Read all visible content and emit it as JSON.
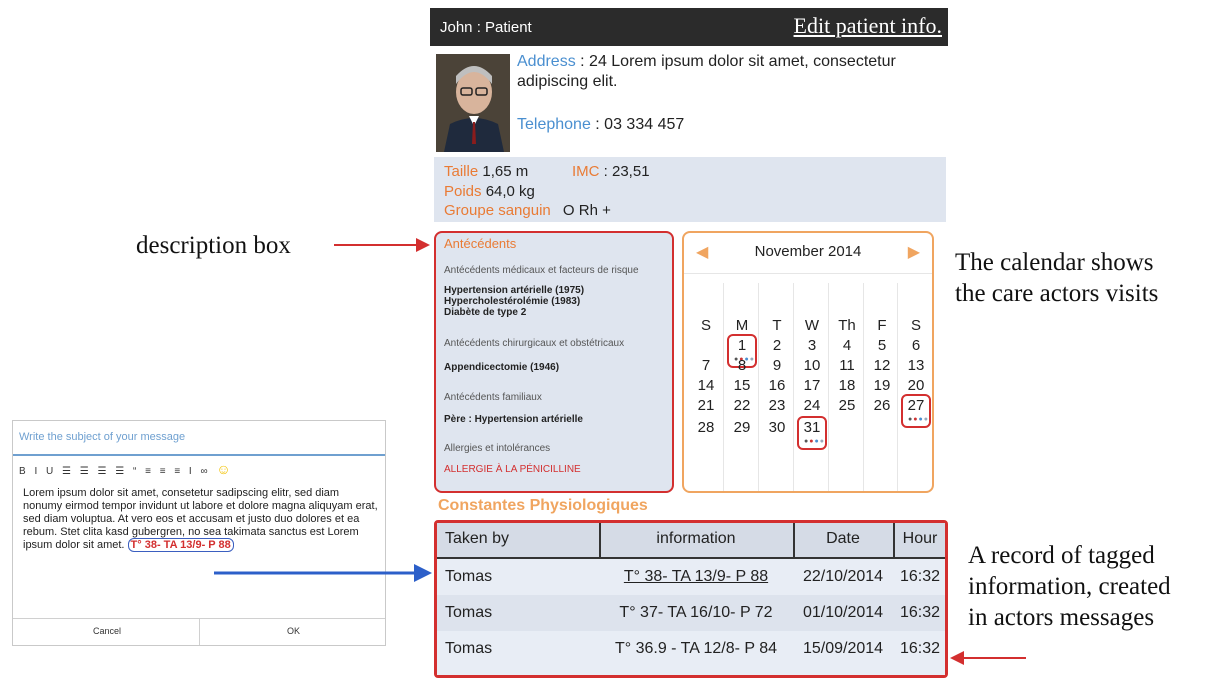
{
  "header": {
    "title": "John : Patient",
    "edit_label": "Edit patient info."
  },
  "patient": {
    "address_label": "Address",
    "address_value": " : 24 Lorem ipsum dolor sit amet, consectetur",
    "address_line2": "adipiscing elit.",
    "phone_label": "Telephone",
    "phone_value": " : 03 334 457"
  },
  "stats": {
    "taille_label": "Taille",
    "taille_value": " 1,65 m",
    "imc_label": "IMC",
    "imc_value": " : 23,51",
    "poids_label": "Poids",
    "poids_value": " 64,0 kg",
    "groupe_label": "Groupe sanguin",
    "groupe_value": "O Rh +"
  },
  "antecedents": {
    "title": "Antécédents",
    "sections": [
      {
        "heading": "Antécédents médicaux et facteurs de risque",
        "items": [
          "Hypertension artérielle (1975)",
          "Hypercholestérolémie (1983)",
          "Diabète de type 2"
        ]
      },
      {
        "heading": "Antécédents chirurgicaux et obstétricaux",
        "items": [
          "Appendicectomie (1946)"
        ]
      },
      {
        "heading": "Antécédents familiaux",
        "items": [
          "Père : Hypertension artérielle"
        ]
      },
      {
        "heading": "Allergies et intolérances",
        "items": [
          "ALLERGIE À LA PÉNICILLINE"
        ]
      }
    ]
  },
  "calendar": {
    "month": "November 2014",
    "prev_icon": "caret-left-icon",
    "next_icon": "caret-right-icon",
    "weekdays": [
      "S",
      "M",
      "T",
      "W",
      "Th",
      "F",
      "S"
    ],
    "weeks": [
      [
        "",
        "1",
        "2",
        "3",
        "4",
        "5",
        "6"
      ],
      [
        "7",
        "8",
        "9",
        "10",
        "11",
        "12",
        "13"
      ],
      [
        "14",
        "15",
        "16",
        "17",
        "18",
        "19",
        "20"
      ],
      [
        "21",
        "22",
        "23",
        "24",
        "25",
        "26",
        "27"
      ],
      [
        "28",
        "29",
        "30",
        "31",
        "",
        "",
        ""
      ]
    ],
    "marked_days": [
      "1",
      "27",
      "31"
    ]
  },
  "constantes": {
    "title": "Constantes Physiologiques",
    "columns": [
      "Taken by",
      "information",
      "Date",
      "Hour"
    ],
    "rows": [
      [
        "Tomas",
        "T° 38- TA 13/9- P 88",
        "22/10/2014",
        "16:32"
      ],
      [
        "Tomas",
        "T° 37- TA 16/10- P 72",
        "01/10/2014",
        "16:32"
      ],
      [
        "Tomas",
        "T° 36.9 - TA 12/8- P 84",
        "15/09/2014",
        "16:32"
      ]
    ]
  },
  "composer": {
    "subject_placeholder": "Write the subject of your message",
    "toolbar": "B I U ☰ ☰ ☰ ☰ “ ≡ ≡ ≡ I ∞",
    "body": "Lorem ipsum dolor sit amet, consetetur sadipscing elitr, sed diam nonumy eirmod tempor invidunt ut labore et dolore magna aliquyam erat, sed diam voluptua. At vero eos et accusam et justo duo dolores et ea rebum. Stet clita kasd gubergren, no sea takimata sanctus est Lorem ipsum dolor sit amet. ",
    "tag": "T° 38- TA 13/9- P 88",
    "cancel_label": "Cancel",
    "ok_label": "OK"
  },
  "annotations": {
    "description_box": "description box",
    "calendar_line1": "The calendar shows",
    "calendar_line2": "the care actors visits",
    "record_line1": "A record of tagged",
    "record_line2": "information, created",
    "record_line3": "in actors messages"
  },
  "colors": {
    "accent_red": "#d32f2f",
    "accent_orange": "#e97b35",
    "link_blue": "#4a8fd0",
    "panel_bg": "#dfe5ef",
    "arrow_blue": "#2c5fc9"
  }
}
